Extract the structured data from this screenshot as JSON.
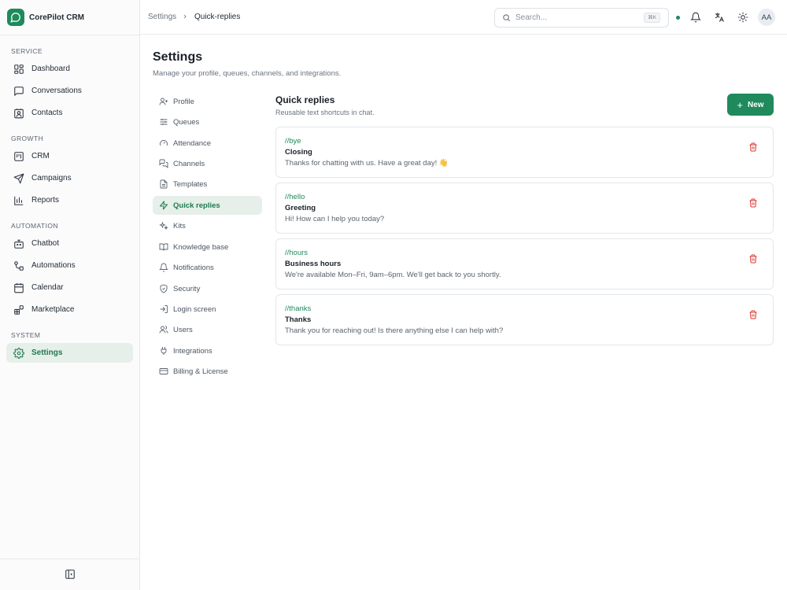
{
  "app": {
    "name": "CorePilot CRM"
  },
  "sidebar": {
    "sections": [
      {
        "label": "SERVICE"
      },
      {
        "label": "GROWTH"
      },
      {
        "label": "AUTOMATION"
      },
      {
        "label": "SYSTEM"
      }
    ],
    "items": [
      {
        "label": "Dashboard",
        "icon": "dashboard-icon"
      },
      {
        "label": "Conversations",
        "icon": "chat-icon"
      },
      {
        "label": "Contacts",
        "icon": "contact-icon"
      },
      {
        "label": "CRM",
        "icon": "kanban-icon"
      },
      {
        "label": "Campaigns",
        "icon": "send-icon"
      },
      {
        "label": "Reports",
        "icon": "bar-chart-icon"
      },
      {
        "label": "Chatbot",
        "icon": "bot-icon"
      },
      {
        "label": "Automations",
        "icon": "workflow-icon"
      },
      {
        "label": "Calendar",
        "icon": "calendar-icon"
      },
      {
        "label": "Marketplace",
        "icon": "blocks-icon"
      },
      {
        "label": "Settings",
        "icon": "gear-icon",
        "active": true
      }
    ]
  },
  "header": {
    "breadcrumb": [
      "Settings",
      "Quick-replies"
    ],
    "search": {
      "placeholder": "Search...",
      "shortcut": "⌘K"
    },
    "avatar_initials": "AA"
  },
  "page": {
    "title": "Settings",
    "subtitle": "Manage your profile, queues, channels, and integrations."
  },
  "settings_nav": [
    {
      "label": "Profile",
      "icon": "user-icon"
    },
    {
      "label": "Queues",
      "icon": "sliders-icon"
    },
    {
      "label": "Attendance",
      "icon": "gauge-icon"
    },
    {
      "label": "Channels",
      "icon": "messages-icon"
    },
    {
      "label": "Templates",
      "icon": "file-icon"
    },
    {
      "label": "Quick replies",
      "icon": "zap-icon",
      "active": true
    },
    {
      "label": "Kits",
      "icon": "sparkles-icon"
    },
    {
      "label": "Knowledge base",
      "icon": "book-icon"
    },
    {
      "label": "Notifications",
      "icon": "bell-icon"
    },
    {
      "label": "Security",
      "icon": "shield-icon"
    },
    {
      "label": "Login screen",
      "icon": "login-icon"
    },
    {
      "label": "Users",
      "icon": "users-icon"
    },
    {
      "label": "Integrations",
      "icon": "plug-icon"
    },
    {
      "label": "Billing & License",
      "icon": "credit-card-icon"
    }
  ],
  "quick_replies": {
    "title": "Quick replies",
    "subtitle": "Reusable text shortcuts in chat.",
    "new_label": "New",
    "items": [
      {
        "shortcut": "//bye",
        "title": "Closing",
        "text": "Thanks for chatting with us. Have a great day! 👋"
      },
      {
        "shortcut": "//hello",
        "title": "Greeting",
        "text": "Hi! How can I help you today?"
      },
      {
        "shortcut": "//hours",
        "title": "Business hours",
        "text": "We're available Mon–Fri, 9am–6pm. We'll get back to you shortly."
      },
      {
        "shortcut": "//thanks",
        "title": "Thanks",
        "text": "Thank you for reaching out! Is there anything else I can help with?"
      }
    ]
  },
  "colors": {
    "accent": "#1f8a5b",
    "active_bg": "#e6efe9",
    "danger": "#d9342b"
  }
}
